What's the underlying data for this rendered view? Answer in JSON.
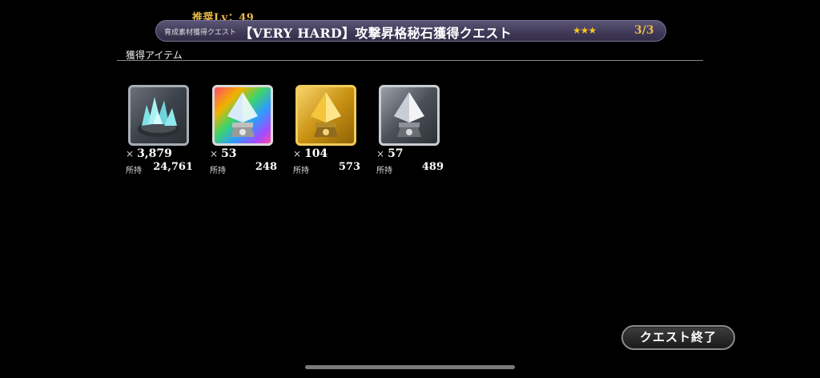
{
  "header": {
    "recommended_level": "推奨Lv：49",
    "category": "育成素材獲得クエスト",
    "title": "【VERY HARD】攻撃昇格秘石獲得クエスト",
    "stars": "★★★",
    "progress": "3/3"
  },
  "rewards": {
    "section_label": "獲得アイテム",
    "times_symbol": "×",
    "owned_label": "所持",
    "items": [
      {
        "icon": "crystal-ore-icon",
        "quantity": "3,879",
        "owned": "24,761"
      },
      {
        "icon": "rainbow-promotion-stone-icon",
        "quantity": "53",
        "owned": "248"
      },
      {
        "icon": "gold-promotion-stone-icon",
        "quantity": "104",
        "owned": "573"
      },
      {
        "icon": "silver-promotion-stone-icon",
        "quantity": "57",
        "owned": "489"
      }
    ]
  },
  "footer": {
    "end_button_label": "クエスト終了"
  },
  "colors": {
    "accent_gold": "#e8b94a",
    "star_yellow": "#f3c423",
    "banner_purple": "#3f3957"
  }
}
